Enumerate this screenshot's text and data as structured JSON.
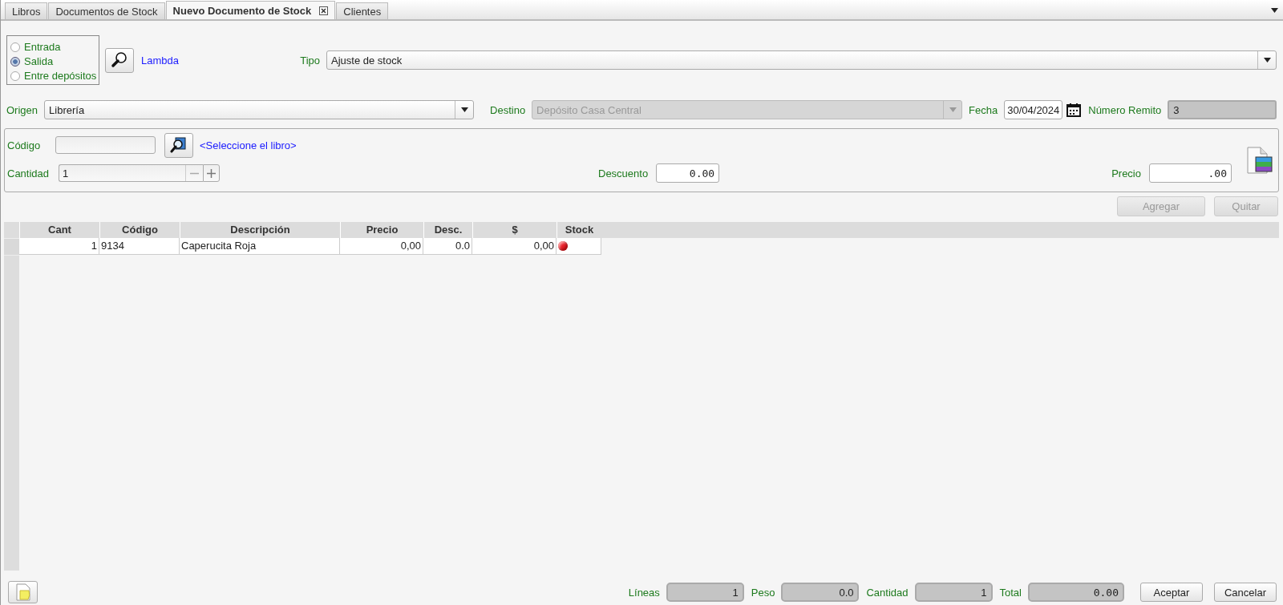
{
  "tabs": [
    {
      "label": "Libros",
      "selected": false,
      "closable": false
    },
    {
      "label": "Documentos de Stock",
      "selected": false,
      "closable": false
    },
    {
      "label": "Nuevo Documento de Stock",
      "selected": true,
      "closable": true
    },
    {
      "label": "Clientes",
      "selected": false,
      "closable": false
    }
  ],
  "movement": [
    {
      "label": "Entrada",
      "selected": false
    },
    {
      "label": "Salida",
      "selected": true
    },
    {
      "label": "Entre depósitos",
      "selected": false
    }
  ],
  "provider_link": "Lambda",
  "tipo": {
    "label": "Tipo",
    "value": "Ajuste de stock"
  },
  "origen": {
    "label": "Origen",
    "value": "Librería",
    "disabled": false
  },
  "destino": {
    "label": "Destino",
    "value": "Depósito Casa Central",
    "disabled": true
  },
  "fecha": {
    "label": "Fecha",
    "value": "30/04/2024"
  },
  "numero_remito": {
    "label": "Número Remito",
    "value": "3"
  },
  "item": {
    "codigo_label": "Código",
    "select_link": "<Seleccione el libro>",
    "cantidad_label": "Cantidad",
    "cantidad": "1",
    "descuento_label": "Descuento",
    "descuento": "0.00",
    "precio_label": "Precio",
    "precio": ".00"
  },
  "actions": [
    {
      "label": "Agregar",
      "disabled": true
    },
    {
      "label": "Quitar",
      "disabled": true
    }
  ],
  "table": {
    "columns": [
      "Cant",
      "Código",
      "Descripción",
      "Precio",
      "Desc.",
      "$",
      "Stock"
    ],
    "rows": [
      {
        "cant": "1",
        "codigo": "9134",
        "descripcion": "Caperucita Roja",
        "precio": "0,00",
        "desc": "0.0",
        "total": "0,00",
        "color": "#e8202a"
      }
    ]
  },
  "totals": [
    {
      "label": "Líneas",
      "value": "1"
    },
    {
      "label": "Peso",
      "value": "0.0"
    },
    {
      "label": "Cantidad",
      "value": "1"
    },
    {
      "label": "Total",
      "value": "0.00",
      "mono": true
    }
  ],
  "buttons": [
    {
      "label": "Aceptar"
    },
    {
      "label": "Cancelar"
    }
  ]
}
